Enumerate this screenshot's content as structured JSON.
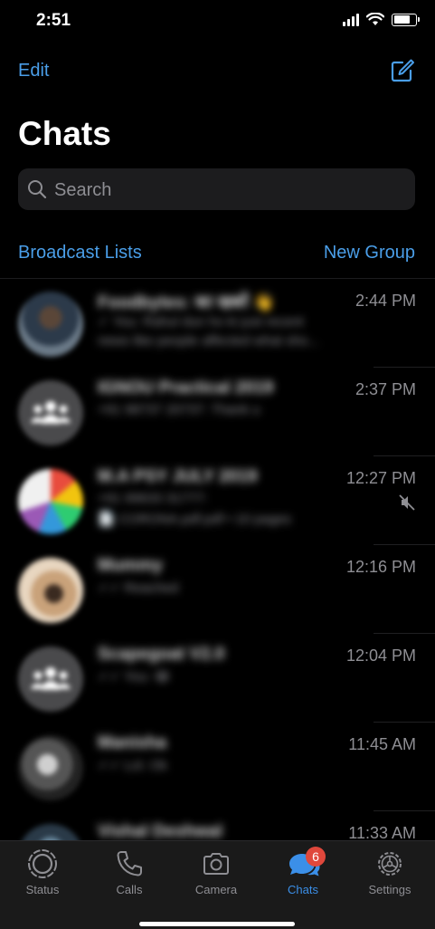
{
  "status_bar": {
    "time": "2:51",
    "battery_fraction": 0.85
  },
  "header": {
    "edit_label": "Edit",
    "title": "Chats",
    "compose_icon": "compose-icon"
  },
  "search": {
    "placeholder": "Search"
  },
  "links": {
    "broadcast": "Broadcast Lists",
    "new_group": "New Group"
  },
  "chats": [
    {
      "name": "Foodbytes: का खबरें 👋",
      "message": "✓ You: Rahul dun ho ki just recent",
      "message2": "news like people affected what sho...",
      "time": "2:44 PM",
      "muted": false
    },
    {
      "name": "IGNOU Practical 2019",
      "message": "+91 98737 20737: Thank u",
      "message2": "",
      "time": "2:37 PM",
      "muted": false
    },
    {
      "name": "M.A PSY JULY 2019",
      "message": "+91 99633 31777:",
      "message2": "📄 CORONA.pdf.pdf • 10 pages",
      "time": "12:27 PM",
      "muted": true
    },
    {
      "name": "Mummy",
      "message": "✓✓ Reached",
      "message2": "",
      "time": "12:16 PM",
      "muted": false
    },
    {
      "name": "Scapegoat V2.0",
      "message": "✓✓ You: 😂",
      "message2": "",
      "time": "12:04 PM",
      "muted": false
    },
    {
      "name": "Manisha",
      "message": "✓✓ Lol. Ok",
      "message2": "",
      "time": "11:45 AM",
      "muted": false
    },
    {
      "name": "Vishal Deshwal",
      "message": "",
      "message2": "",
      "time": "11:33 AM",
      "muted": false
    }
  ],
  "tabs": [
    {
      "label": "Status",
      "icon": "status-icon"
    },
    {
      "label": "Calls",
      "icon": "phone-icon"
    },
    {
      "label": "Camera",
      "icon": "camera-icon"
    },
    {
      "label": "Chats",
      "icon": "chats-icon",
      "badge": "6"
    },
    {
      "label": "Settings",
      "icon": "gear-icon"
    }
  ],
  "colors": {
    "accent": "#4a9ee8",
    "badge": "#e0483c",
    "background": "#000000"
  }
}
